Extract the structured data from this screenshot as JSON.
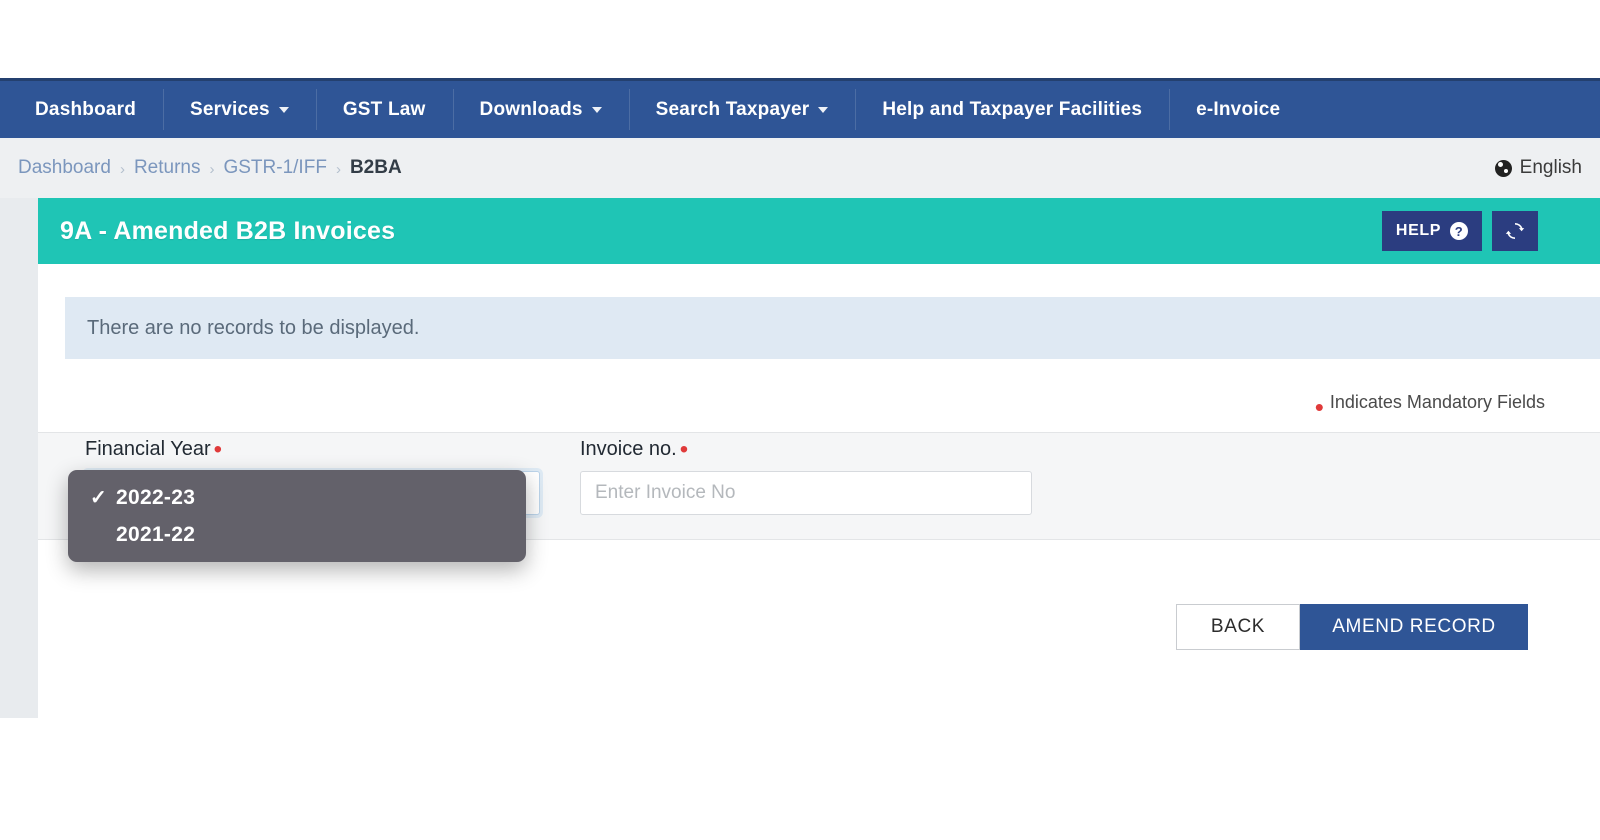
{
  "navbar": {
    "items": [
      {
        "label": "Dashboard",
        "has_caret": false
      },
      {
        "label": "Services",
        "has_caret": true
      },
      {
        "label": "GST Law",
        "has_caret": false
      },
      {
        "label": "Downloads",
        "has_caret": true
      },
      {
        "label": "Search Taxpayer",
        "has_caret": true
      },
      {
        "label": "Help and Taxpayer Facilities",
        "has_caret": false
      },
      {
        "label": "e-Invoice",
        "has_caret": false
      }
    ],
    "background": "#2f5596"
  },
  "breadcrumb": {
    "items": [
      {
        "label": "Dashboard",
        "active": false
      },
      {
        "label": "Returns",
        "active": false
      },
      {
        "label": "GSTR-1/IFF",
        "active": false
      },
      {
        "label": "B2BA",
        "active": true
      }
    ],
    "separator": "›",
    "language": {
      "icon": "globe-icon",
      "label": "English"
    }
  },
  "section": {
    "title": "9A - Amended B2B Invoices",
    "accent": "#1fc5b5",
    "help_label": "HELP",
    "help_icon": "question-circle-icon",
    "refresh_icon": "refresh-icon"
  },
  "banner": {
    "message": "There are no records to be displayed.",
    "background": "#dfe9f3"
  },
  "mandatory_note": {
    "marker": "•",
    "text": "Indicates Mandatory Fields",
    "marker_color": "#e03a3a"
  },
  "form": {
    "financial_year": {
      "label": "Financial Year",
      "required_marker": "•",
      "selected": "2022-23",
      "options": [
        {
          "label": "2022-23",
          "selected": true
        },
        {
          "label": "2021-22",
          "selected": false
        }
      ],
      "check_glyph": "✓"
    },
    "invoice_no": {
      "label": "Invoice no.",
      "required_marker": "•",
      "value": "",
      "placeholder": "Enter Invoice No"
    }
  },
  "actions": {
    "back_label": "BACK",
    "amend_label": "AMEND RECORD",
    "amend_color": "#2f5596"
  }
}
